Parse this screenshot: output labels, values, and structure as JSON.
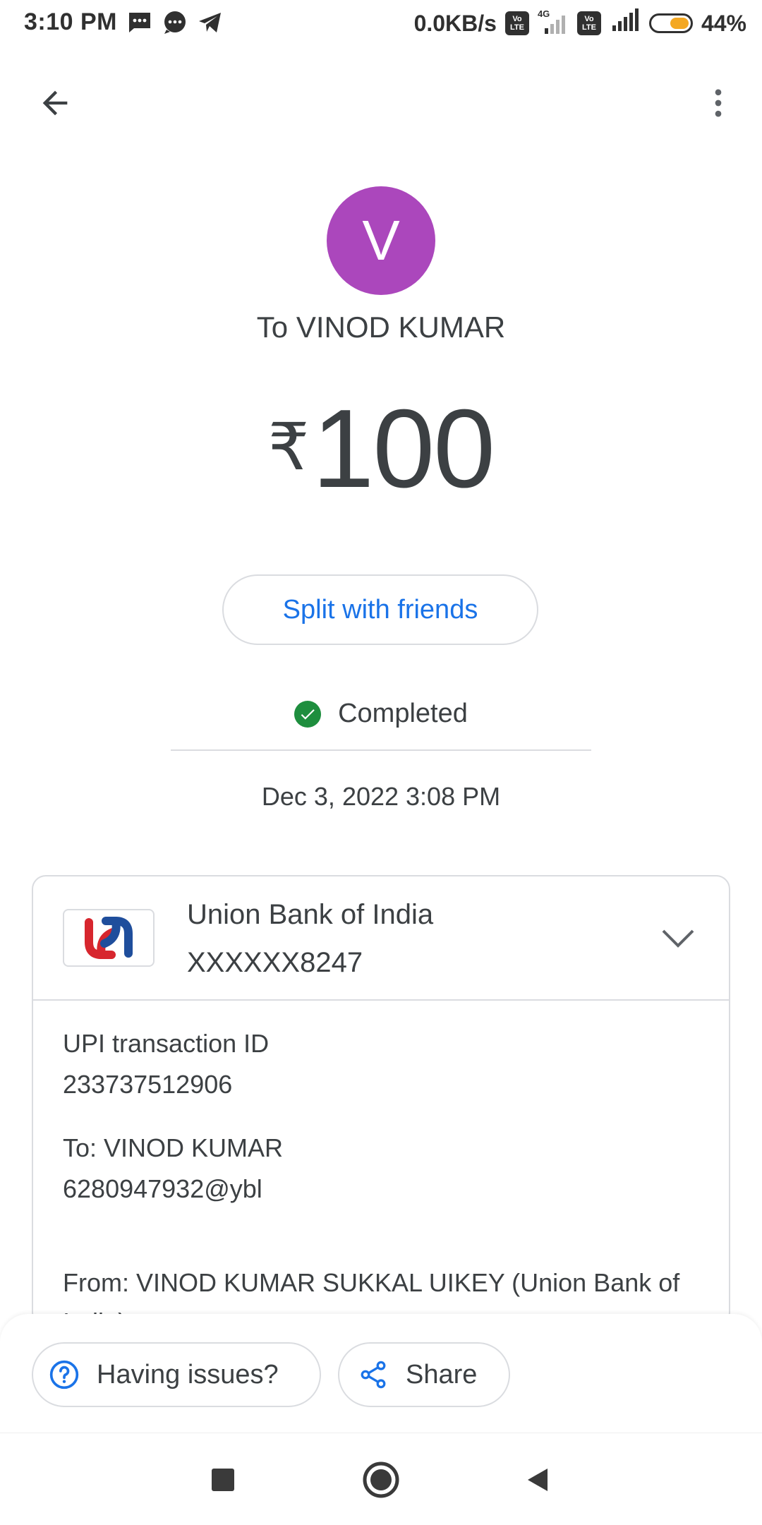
{
  "status_bar": {
    "time": "3:10 PM",
    "speed": "0.0KB/s",
    "net_type": "4G",
    "volte_label_top": "Vo",
    "volte_label_bottom": "LTE",
    "battery": "44%",
    "battery_level": 0.44,
    "icons": [
      "sms-icon",
      "chat-icon",
      "telegram-icon",
      "volte-icon",
      "signal-icon",
      "battery-icon"
    ]
  },
  "header": {
    "back_icon": "arrow-left-icon",
    "more_icon": "more-vertical-icon"
  },
  "payee": {
    "avatar_letter": "V",
    "avatar_color": "#ab47bc",
    "title": "To VINOD KUMAR"
  },
  "amount": {
    "currency": "₹",
    "value": "100"
  },
  "split_button": "Split with friends",
  "transaction_status": {
    "label": "Completed",
    "icon": "check-circle-icon",
    "color": "#1e8e3e"
  },
  "timestamp": "Dec 3, 2022 3:08 PM",
  "bank_card": {
    "bank_name": "Union Bank of India",
    "account": "XXXXXX8247",
    "logo": "union-bank-logo",
    "details": {
      "upi_label": "UPI transaction ID",
      "upi_id": "233737512906",
      "to_label": "To: VINOD KUMAR",
      "to_vpa": "6280947932@ybl",
      "from_text": "From: VINOD KUMAR SUKKAL UIKEY (Union Bank of India)"
    }
  },
  "actions": {
    "issues": "Having issues?",
    "share": "Share"
  },
  "navbar": {
    "recents_icon": "square-icon",
    "home_icon": "circle-icon",
    "back_icon": "triangle-back-icon"
  },
  "colors": {
    "accent": "#1a73e8",
    "text": "#3c4043",
    "border": "#dadce0"
  }
}
